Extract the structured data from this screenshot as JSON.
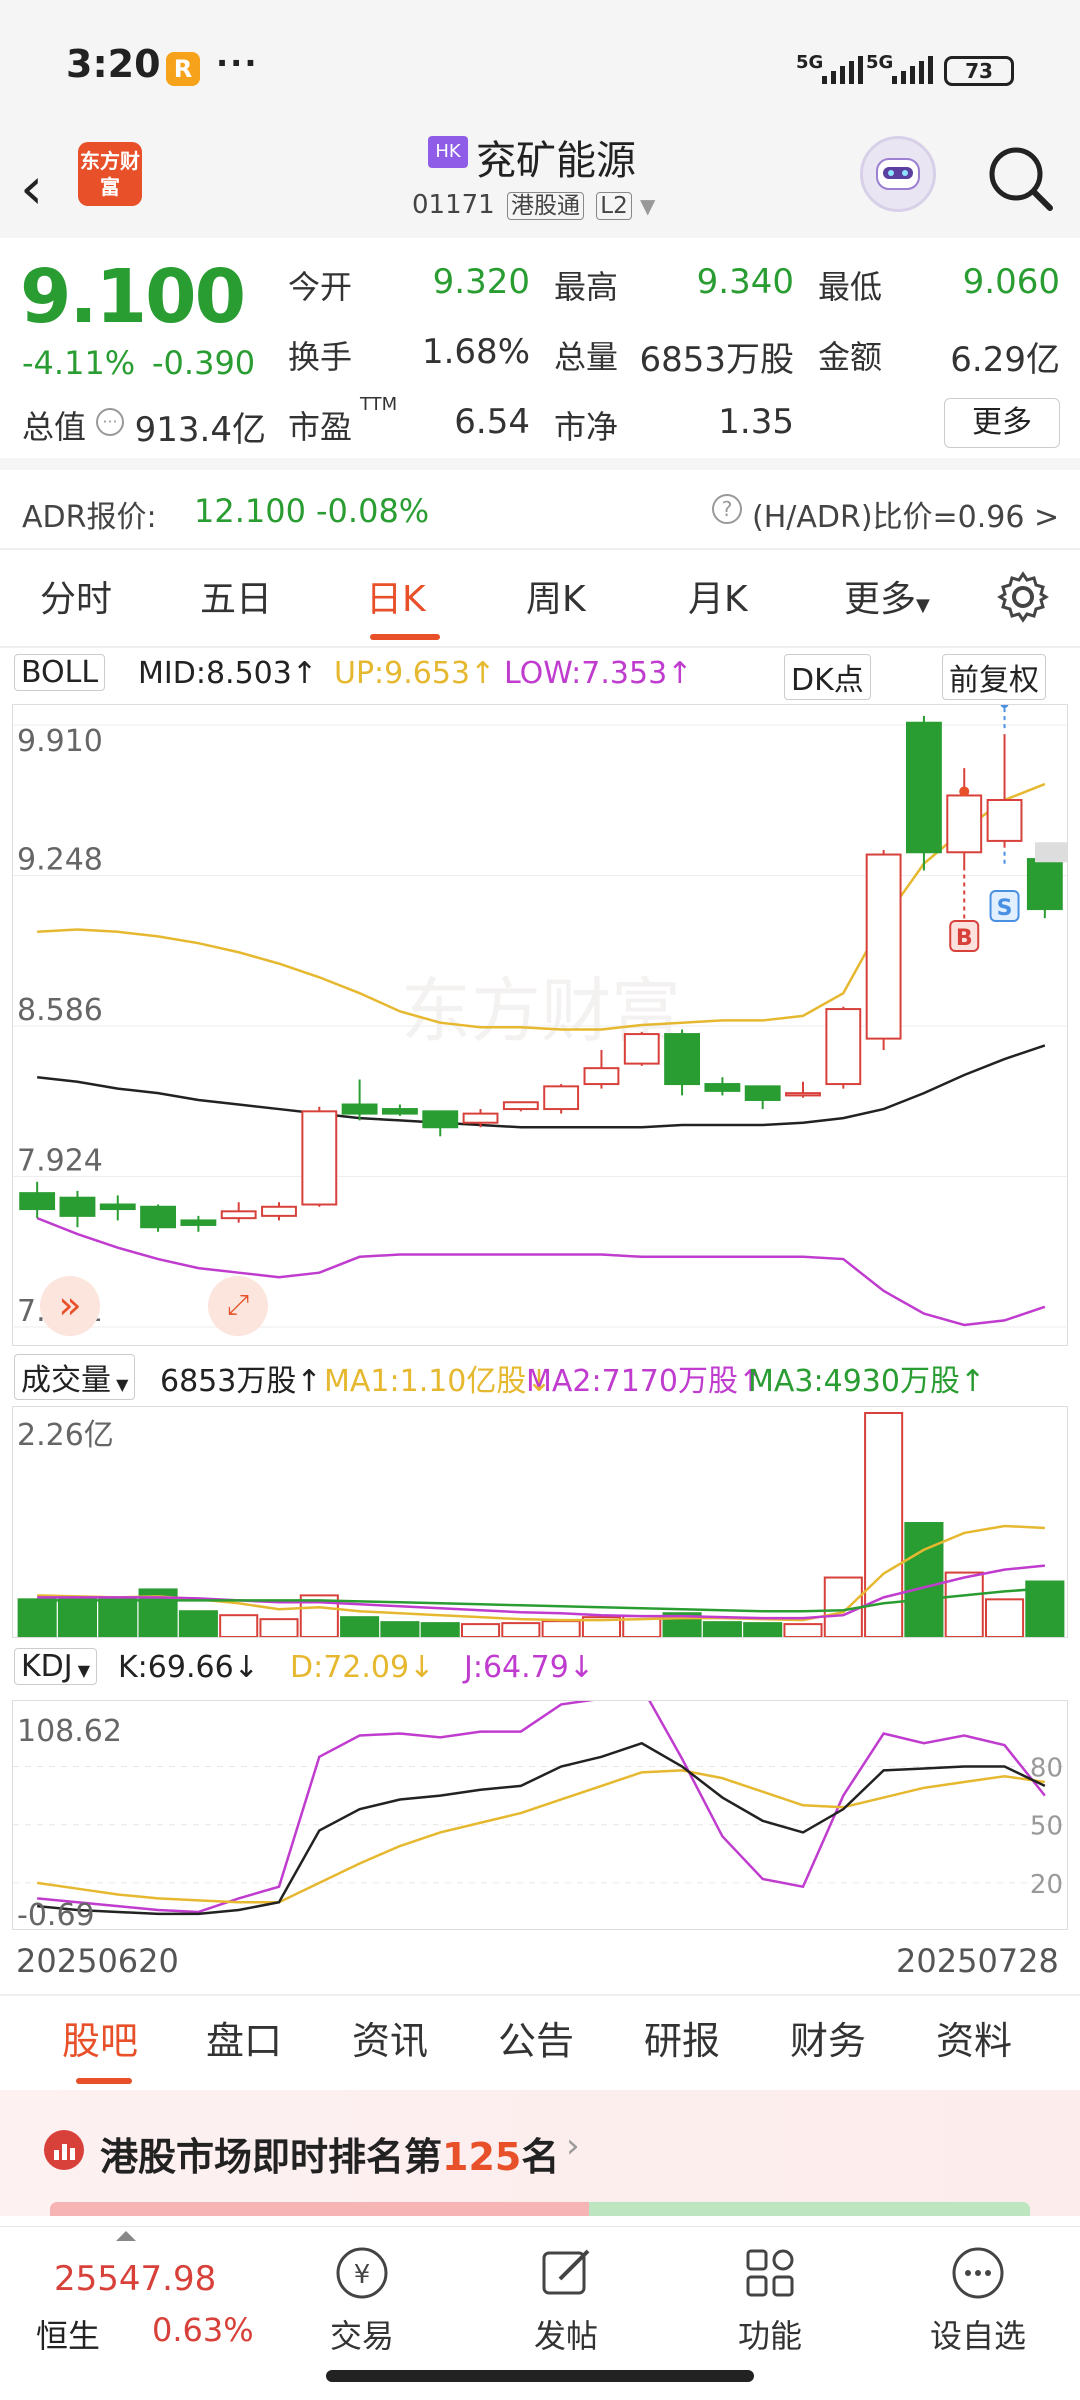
{
  "status_bar": {
    "time": "3:20",
    "r_icon": "R",
    "dots": "···",
    "sig1": "5G",
    "sig2": "5G",
    "battery": "73"
  },
  "header": {
    "logo_text": "东方财富",
    "badge": "HK",
    "name": "兖矿能源",
    "code": "01171",
    "tag1": "港股通",
    "tag2": "L2"
  },
  "quote": {
    "price": "9.100",
    "change_pct": "-4.11%",
    "change": "-0.390",
    "open_label": "今开",
    "open": "9.320",
    "high_label": "最高",
    "high": "9.340",
    "low_label": "最低",
    "low": "9.060",
    "turnover_label": "换手",
    "turnover": "1.68%",
    "volume_label": "总量",
    "volume": "6853万股",
    "amount_label": "金额",
    "amount": "6.29亿",
    "mcap_label": "总值",
    "mcap": "913.4亿",
    "pe_label": "市盈",
    "pe_sup": "TTM",
    "pe": "6.54",
    "pb_label": "市净",
    "pb": "1.35",
    "more": "更多"
  },
  "adr": {
    "label": "ADR报价:",
    "price": "12.100",
    "change": "-0.08%",
    "ratio": "(H/ADR)比价=0.96 >"
  },
  "tabs": [
    "分时",
    "五日",
    "日K",
    "周K",
    "月K",
    "更多"
  ],
  "active_tab": "日K",
  "boll": {
    "name": "BOLL",
    "mid": "MID:8.503↑",
    "up": "UP:9.653↑",
    "low": "LOW:7.353↑",
    "dk": "DK点",
    "adj": "前复权",
    "watermark": "东方财富",
    "y_labels": [
      "9.910",
      "9.248",
      "8.586",
      "7.924",
      "7.261"
    ],
    "b_marker": "B",
    "s_marker": "S"
  },
  "volume": {
    "name": "成交量",
    "value": "6853万股↑",
    "ma1": "MA1:1.10亿股↓",
    "ma2": "MA2:7170万股↑",
    "ma3": "MA3:4930万股↑",
    "max_label": "2.26亿"
  },
  "kdj": {
    "name": "KDJ",
    "k": "K:69.66↓",
    "d": "D:72.09↓",
    "j": "J:64.79↓",
    "y_top": "108.62",
    "y_bottom": "-0.69",
    "levels": [
      "80",
      "50",
      "20"
    ]
  },
  "dates": {
    "start": "20250620",
    "end": "20250728"
  },
  "subtabs": [
    "股吧",
    "盘口",
    "资讯",
    "公告",
    "研报",
    "财务",
    "资料"
  ],
  "rank": {
    "prefix": "港股市场即时排名第",
    "num": "125",
    "suffix": "名"
  },
  "bottom_nav": {
    "index_value": "25547.98",
    "index_name": "恒生",
    "index_change": "0.63%",
    "items": [
      "交易",
      "发帖",
      "功能",
      "设自选"
    ]
  },
  "colors": {
    "up_red": "#d8403a",
    "down_green": "#2a9d32",
    "accent": "#e8502a",
    "mid_line": "#222222",
    "up_line": "#e6b830",
    "low_line": "#c03ccf"
  },
  "chart_data": {
    "type": "candlestick",
    "candles": [
      {
        "o": 7.85,
        "c": 7.78,
        "h": 7.9,
        "l": 7.74
      },
      {
        "o": 7.83,
        "c": 7.75,
        "h": 7.86,
        "l": 7.7
      },
      {
        "o": 7.8,
        "c": 7.78,
        "h": 7.84,
        "l": 7.73
      },
      {
        "o": 7.79,
        "c": 7.7,
        "h": 7.8,
        "l": 7.68
      },
      {
        "o": 7.73,
        "c": 7.71,
        "h": 7.75,
        "l": 7.68
      },
      {
        "o": 7.74,
        "c": 7.77,
        "h": 7.81,
        "l": 7.72
      },
      {
        "o": 7.75,
        "c": 7.79,
        "h": 7.81,
        "l": 7.73
      },
      {
        "o": 7.8,
        "c": 8.21,
        "h": 8.23,
        "l": 7.79
      },
      {
        "o": 8.24,
        "c": 8.2,
        "h": 8.35,
        "l": 8.17
      },
      {
        "o": 8.22,
        "c": 8.2,
        "h": 8.24,
        "l": 8.19
      },
      {
        "o": 8.21,
        "c": 8.14,
        "h": 8.21,
        "l": 8.1
      },
      {
        "o": 8.16,
        "c": 8.2,
        "h": 8.22,
        "l": 8.14
      },
      {
        "o": 8.22,
        "c": 8.25,
        "h": 8.24,
        "l": 8.21
      },
      {
        "o": 8.22,
        "c": 8.32,
        "h": 8.33,
        "l": 8.2
      },
      {
        "o": 8.33,
        "c": 8.4,
        "h": 8.48,
        "l": 8.31
      },
      {
        "o": 8.42,
        "c": 8.55,
        "h": 8.56,
        "l": 8.41
      },
      {
        "o": 8.55,
        "c": 8.33,
        "h": 8.57,
        "l": 8.28
      },
      {
        "o": 8.33,
        "c": 8.3,
        "h": 8.36,
        "l": 8.28
      },
      {
        "o": 8.32,
        "c": 8.26,
        "h": 8.32,
        "l": 8.22
      },
      {
        "o": 8.28,
        "c": 8.29,
        "h": 8.34,
        "l": 8.27
      },
      {
        "o": 8.33,
        "c": 8.66,
        "h": 8.67,
        "l": 8.31
      },
      {
        "o": 8.53,
        "c": 9.34,
        "h": 9.36,
        "l": 8.48
      },
      {
        "o": 9.92,
        "c": 9.35,
        "h": 9.95,
        "l": 9.27
      },
      {
        "o": 9.35,
        "c": 9.6,
        "h": 9.72,
        "l": 9.27
      },
      {
        "o": 9.4,
        "c": 9.58,
        "h": 9.87,
        "l": 9.37
      },
      {
        "o": 9.32,
        "c": 9.1,
        "h": 9.34,
        "l": 9.06
      }
    ],
    "boll_mid": [
      8.36,
      8.34,
      8.31,
      8.29,
      8.26,
      8.24,
      8.22,
      8.2,
      8.18,
      8.17,
      8.16,
      8.15,
      8.14,
      8.14,
      8.14,
      8.14,
      8.15,
      8.15,
      8.15,
      8.16,
      8.18,
      8.22,
      8.29,
      8.37,
      8.44,
      8.5
    ],
    "boll_up": [
      9.0,
      9.01,
      9.0,
      8.98,
      8.95,
      8.91,
      8.86,
      8.8,
      8.73,
      8.65,
      8.6,
      8.58,
      8.58,
      8.57,
      8.57,
      8.59,
      8.6,
      8.61,
      8.61,
      8.63,
      8.73,
      9.05,
      9.3,
      9.45,
      9.58,
      9.65
    ],
    "boll_low": [
      7.74,
      7.67,
      7.61,
      7.56,
      7.52,
      7.5,
      7.48,
      7.5,
      7.57,
      7.58,
      7.58,
      7.58,
      7.58,
      7.58,
      7.58,
      7.57,
      7.57,
      7.57,
      7.57,
      7.57,
      7.56,
      7.42,
      7.32,
      7.27,
      7.29,
      7.35
    ],
    "boll_ylim": [
      7.261,
      9.91
    ],
    "volume": [
      0.38,
      0.38,
      0.38,
      0.48,
      0.26,
      0.22,
      0.18,
      0.42,
      0.2,
      0.15,
      0.14,
      0.13,
      0.14,
      0.16,
      0.2,
      0.21,
      0.24,
      0.15,
      0.14,
      0.13,
      0.6,
      2.26,
      1.15,
      0.65,
      0.38,
      0.56
    ],
    "volume_ylim": [
      0,
      2.26
    ],
    "vol_ma1": [
      0.42,
      0.41,
      0.4,
      0.41,
      0.38,
      0.34,
      0.28,
      0.3,
      0.26,
      0.24,
      0.22,
      0.2,
      0.18,
      0.17,
      0.17,
      0.18,
      0.19,
      0.19,
      0.18,
      0.17,
      0.25,
      0.64,
      0.88,
      1.05,
      1.12,
      1.1
    ],
    "vol_ma2": [
      0.4,
      0.4,
      0.4,
      0.4,
      0.39,
      0.37,
      0.35,
      0.35,
      0.33,
      0.31,
      0.29,
      0.27,
      0.25,
      0.24,
      0.22,
      0.21,
      0.21,
      0.2,
      0.19,
      0.19,
      0.22,
      0.4,
      0.5,
      0.6,
      0.68,
      0.72
    ],
    "vol_ma3": [
      0.37,
      0.37,
      0.37,
      0.37,
      0.37,
      0.37,
      0.37,
      0.37,
      0.36,
      0.35,
      0.34,
      0.33,
      0.32,
      0.31,
      0.3,
      0.29,
      0.28,
      0.27,
      0.26,
      0.26,
      0.27,
      0.34,
      0.38,
      0.42,
      0.46,
      0.49
    ],
    "kdj_k": [
      8,
      6,
      5,
      4,
      4,
      6,
      10,
      47,
      58,
      63,
      65,
      68,
      70,
      80,
      85,
      92,
      80,
      64,
      52,
      46,
      58,
      78,
      79,
      80,
      80,
      70
    ],
    "kdj_d": [
      20,
      17,
      14,
      12,
      11,
      10,
      10,
      20,
      30,
      39,
      46,
      51,
      56,
      63,
      70,
      77,
      78,
      74,
      67,
      60,
      59,
      64,
      69,
      72,
      75,
      72
    ],
    "kdj_j": [
      12,
      10,
      8,
      6,
      5,
      12,
      18,
      85,
      96,
      97,
      95,
      98,
      98,
      112,
      115,
      121,
      84,
      44,
      22,
      18,
      65,
      97,
      92,
      96,
      91,
      65
    ],
    "kdj_ylim": [
      -0.69,
      108.62
    ],
    "kdj_levels": [
      80,
      50,
      20
    ],
    "x_range": [
      "20250620",
      "20250728"
    ]
  }
}
